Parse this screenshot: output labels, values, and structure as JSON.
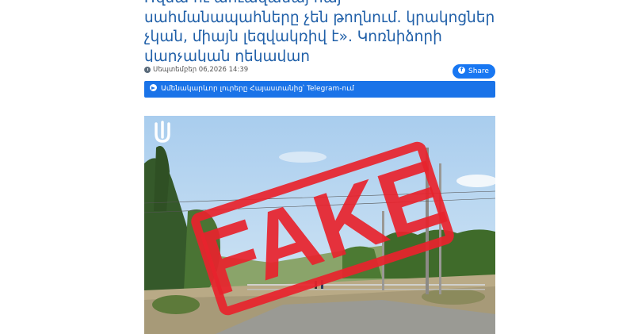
{
  "article": {
    "headline_line0": "Ռզմա ու աուազանայ հայ",
    "headline_line1": "սահմանապահները չեն թողնում. կրակոցներ",
    "headline_line2": "չկան, միայն լեզվակռիվ է». Կոռնիձորի",
    "headline_line3": "վարչական ղեկավար",
    "date": "Սեպտեմբեր 06,2026 14:39",
    "share_label": "Share",
    "telegram_label": "Ամենակարևոր լուրերը Հայաստանից՝ Telegram-ում"
  },
  "photo": {
    "stamp_text": "FAKE",
    "logo_icon": "broadcaster-logo-icon",
    "stamp_color": "#e8232d"
  },
  "icons": {
    "clock": "clock-icon",
    "facebook": "facebook-icon",
    "telegram": "telegram-icon"
  },
  "colors": {
    "headline": "#1f5fa8",
    "share": "#1877f2",
    "telegram": "#1a73e8"
  }
}
